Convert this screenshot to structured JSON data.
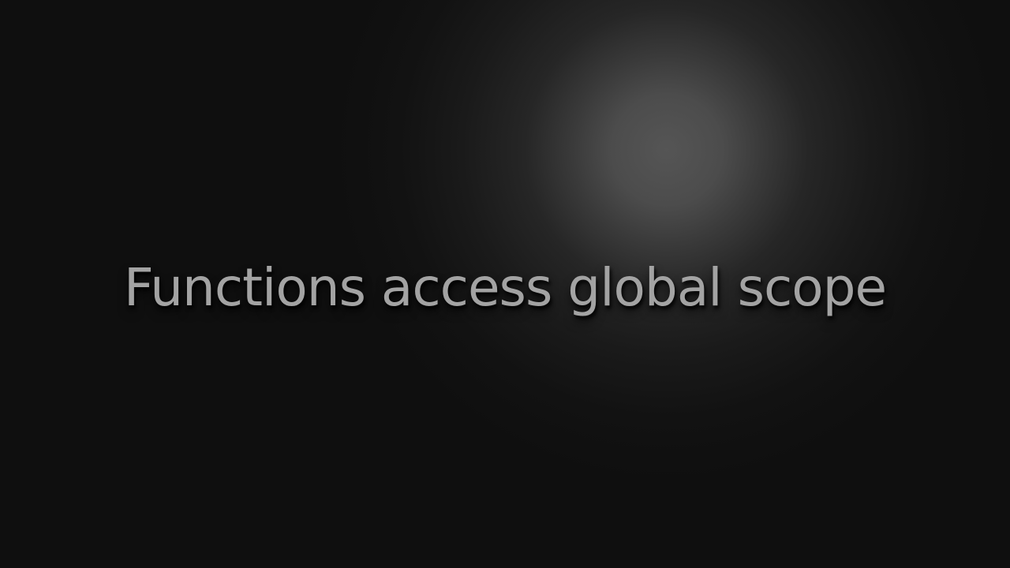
{
  "slide": {
    "title": "Functions access global scope",
    "background_color": "#0f0f0f",
    "spotlight_color": "#555555",
    "title_color": "#a3a3a3"
  }
}
